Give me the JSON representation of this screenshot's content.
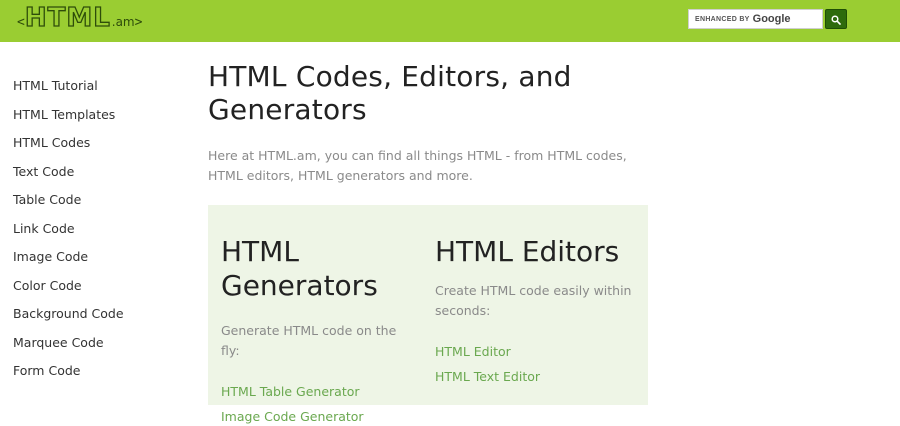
{
  "logo": {
    "bracket_left": "<",
    "main": "HTML",
    "suffix": ".am",
    "bracket_right": ">"
  },
  "search": {
    "enhanced_label": "ENHANCED BY",
    "provider": "Google",
    "button_icon": "search-icon"
  },
  "sidebar": {
    "items": [
      {
        "label": "HTML Tutorial"
      },
      {
        "label": "HTML Templates"
      },
      {
        "label": "HTML Codes"
      },
      {
        "label": "Text Code"
      },
      {
        "label": "Table Code"
      },
      {
        "label": "Link Code"
      },
      {
        "label": "Image Code"
      },
      {
        "label": "Color Code"
      },
      {
        "label": "Background Code"
      },
      {
        "label": "Marquee Code"
      },
      {
        "label": "Form Code"
      }
    ]
  },
  "main": {
    "title": "HTML Codes, Editors, and Generators",
    "intro": "Here at HTML.am, you can find all things HTML - from HTML codes, HTML editors, HTML generators and more.",
    "generators": {
      "title": "HTML Generators",
      "description": "Generate HTML code on the fly:",
      "links": [
        "HTML Table Generator",
        "Image Code Generator"
      ]
    },
    "editors": {
      "title": "HTML Editors",
      "description": "Create HTML code easily within seconds:",
      "links": [
        "HTML Editor",
        "HTML Text Editor"
      ]
    }
  },
  "colors": {
    "header_bg": "#9acd32",
    "logo_dark": "#2e4d0a",
    "search_button": "#2e6b0c",
    "panel_bg": "#eef5e6",
    "link": "#6aa84f",
    "muted_text": "#8a8a8a"
  }
}
